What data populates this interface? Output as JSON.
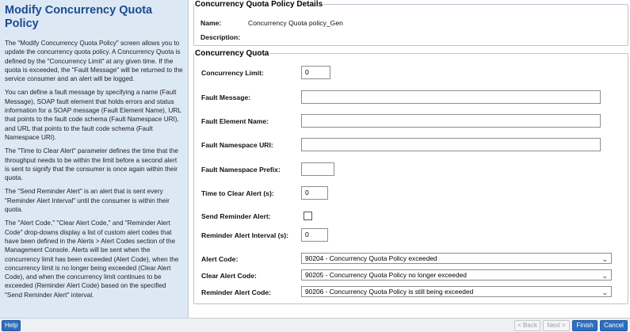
{
  "help": {
    "title": "Modify Concurrency Quota Policy",
    "paragraphs": [
      "The \"Modify Concurrency Quota Policy\" screen allows you to update the concurrency quota policy. A Concurrency Quota is defined by the \"Concurrency Limit\" at any given time. If the quota is exceeded, the \"Fault Message\" will be returned to the service consumer and an alert will be logged.",
      "You can define a fault message by specifying a name (Fault Message), SOAP fault element that holds errors and status information for a SOAP message (Fault Element Name), URL that points to the fault code schema (Fault Namespace URI), and URL that points to the fault code schema (Fault Namespace URI).",
      "The \"Time to Clear Alert\" parameter defines the time that the throughput needs to be within the limit before a second alert is sent to signify that the consumer is once again within their quota.",
      "The \"Send Reminder Alert\" is an alert that is sent every \"Reminder Alert Interval\" until the consumer is within their quota.",
      "The \"Alert Code,\" \"Clear Alert Code,\" and \"Reminder Alert Code\" drop-downs display a list of custom alert codes that have been defined in the Alerts > Alert Codes section of the Management Console. Alerts will be sent when the concurrency limit has been exceeded (Alert Code), when the concurrency limit is no longer being exceeded (Clear Alert Code), and when the concurrency limit continues to be exceeded (Reminder Alert Code) based on the specified \"Send Reminder Alert\" interval."
    ]
  },
  "details": {
    "legend": "Concurrency Quota Policy Details",
    "name_label": "Name:",
    "name_value": "Concurrency Quota policy_Gen",
    "description_label": "Description:",
    "description_value": ""
  },
  "quota": {
    "legend": "Concurrency Quota",
    "concurrency_limit_label": "Concurrency Limit:",
    "concurrency_limit_value": "0",
    "fault_message_label": "Fault Message:",
    "fault_message_value": "",
    "fault_element_label": "Fault Element Name:",
    "fault_element_value": "",
    "fault_ns_uri_label": "Fault Namespace URI:",
    "fault_ns_uri_value": "",
    "fault_ns_prefix_label": "Fault Namespace Prefix:",
    "fault_ns_prefix_value": "",
    "time_to_clear_label": "Time to Clear Alert (s):",
    "time_to_clear_value": "0",
    "send_reminder_label": "Send Reminder Alert:",
    "send_reminder_checked": false,
    "reminder_interval_label": "Reminder Alert Interval (s):",
    "reminder_interval_value": "0",
    "alert_code_label": "Alert Code:",
    "alert_code_value": "90204 - Concurrency Quota Policy exceeded",
    "clear_alert_code_label": "Clear Alert Code:",
    "clear_alert_code_value": "90205 - Concurrency Quota Policy no longer exceeded",
    "reminder_alert_code_label": "Reminder Alert Code:",
    "reminder_alert_code_value": "90206 - Concurrency Quota Policy is still being exceeded"
  },
  "footer": {
    "help": "Help",
    "back": "< Back",
    "next": "Next >",
    "finish": "Finish",
    "cancel": "Cancel"
  }
}
